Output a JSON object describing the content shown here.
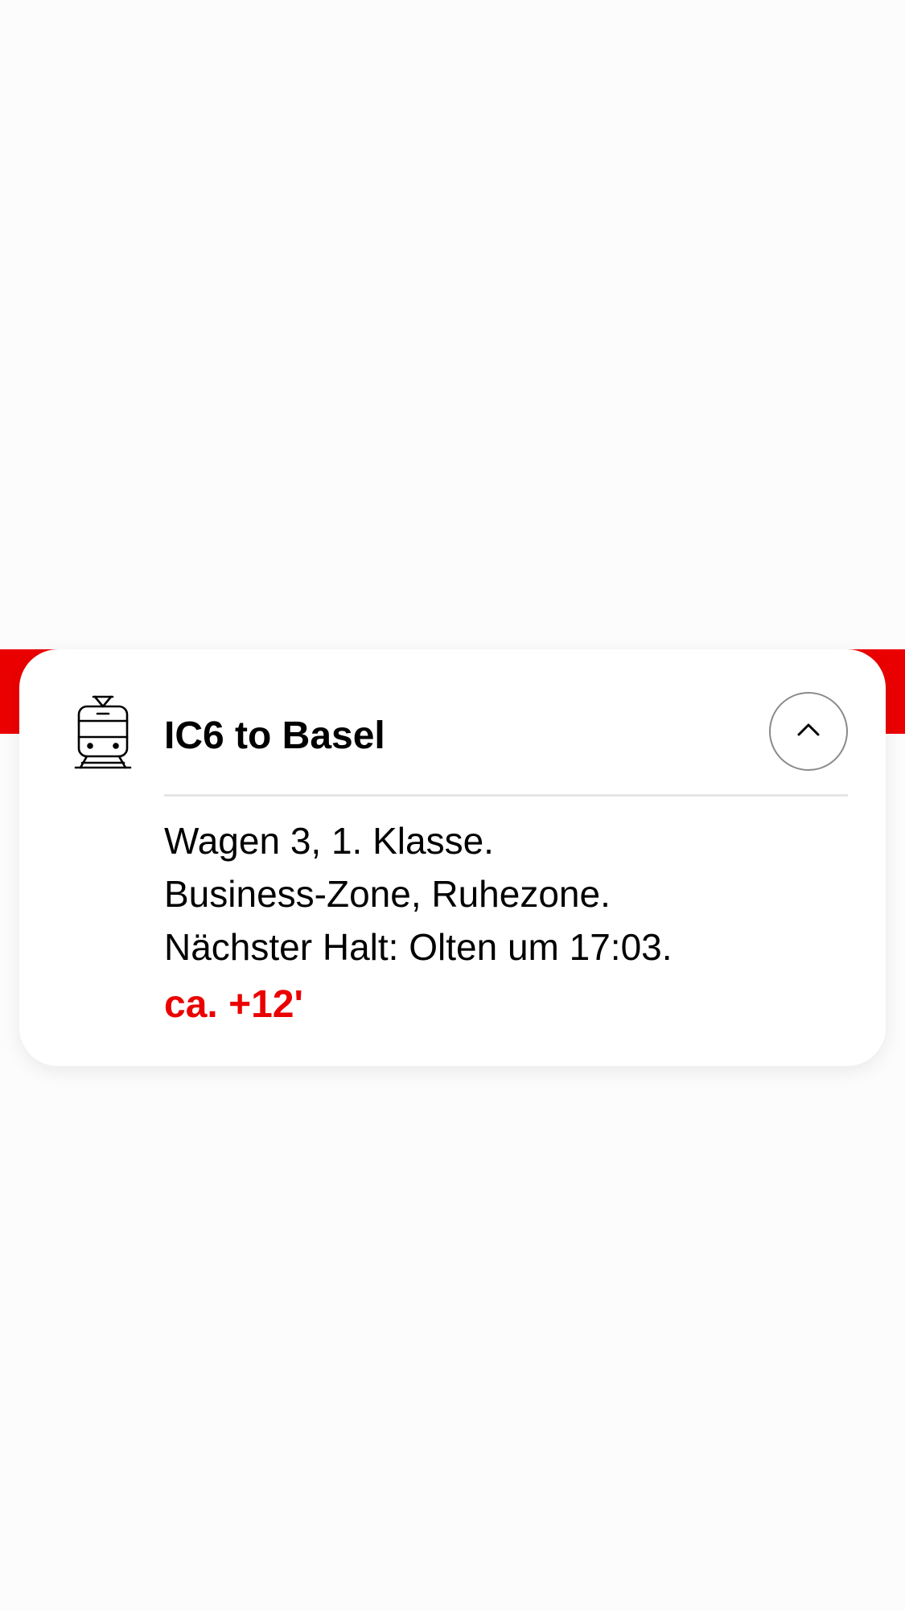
{
  "colors": {
    "brand_red": "#eb0000",
    "text": "#000000",
    "divider": "#e5e5e5",
    "button_border": "#8a8a8a"
  },
  "card": {
    "icon": "train-icon",
    "title": "IC6 to Basel",
    "collapse_icon": "chevron-up-icon",
    "details": [
      "Wagen 3, 1. Klasse.",
      "Business-Zone, Ruhezone.",
      "Nächster Halt: Olten um 17:03."
    ],
    "delay": "ca. +12'"
  }
}
